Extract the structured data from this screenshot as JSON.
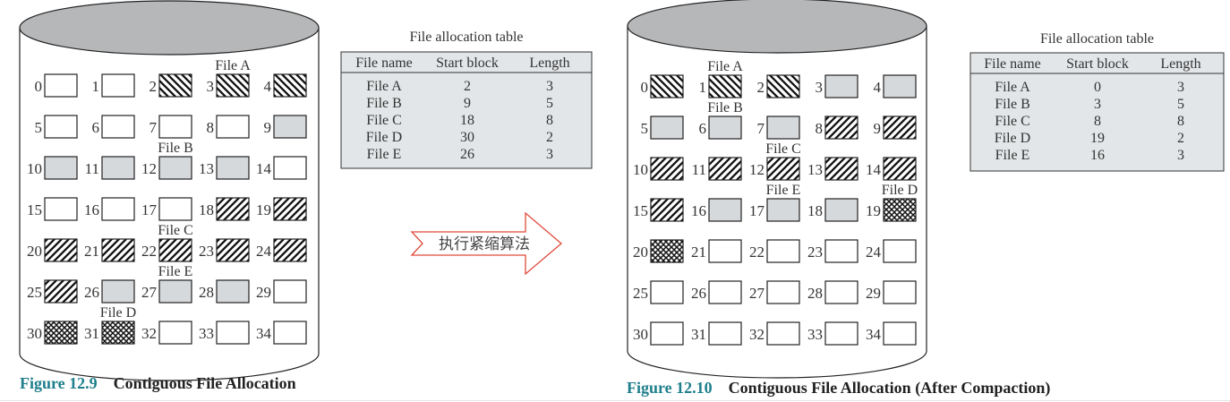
{
  "colors": {
    "used": "#d6d9db",
    "table_bg": "#e3e6e8",
    "cylinder_top": "#b5b7b9",
    "caption_accent": "#1f7f8c",
    "arrow": "#e04a3a"
  },
  "legend_patterns": {
    "A": "back-diagonal-hatch",
    "B": "grey-fill",
    "C": "forward-diagonal-hatch",
    "D": "cross-hatch",
    "E": "grey-fill"
  },
  "before": {
    "caption_num": "Figure 12.9",
    "caption_text": "Contiguous File Allocation",
    "blocks": [
      "empty",
      "empty",
      "A",
      "A",
      "A",
      "empty",
      "empty",
      "empty",
      "empty",
      "B",
      "B",
      "B",
      "B",
      "B",
      "empty",
      "empty",
      "empty",
      "empty",
      "C",
      "C",
      "C",
      "C",
      "C",
      "C",
      "C",
      "C",
      "E",
      "E",
      "E",
      "empty",
      "D",
      "D",
      "empty",
      "empty",
      "empty"
    ],
    "file_labels": [
      {
        "text": "File A",
        "row": 0,
        "col": 3
      },
      {
        "text": "File B",
        "row": 2,
        "col": 2
      },
      {
        "text": "File C",
        "row": 4,
        "col": 2
      },
      {
        "text": "File E",
        "row": 5,
        "col": 2
      },
      {
        "text": "File D",
        "row": 6,
        "col": 1
      }
    ],
    "table": {
      "title": "File allocation table",
      "headers": [
        "File name",
        "Start block",
        "Length"
      ],
      "rows": [
        [
          "File A",
          "2",
          "3"
        ],
        [
          "File B",
          "9",
          "5"
        ],
        [
          "File C",
          "18",
          "8"
        ],
        [
          "File D",
          "30",
          "2"
        ],
        [
          "File E",
          "26",
          "3"
        ]
      ]
    }
  },
  "arrow_label": "执行紧缩算法",
  "after": {
    "caption_num": "Figure 12.10",
    "caption_text": "Contiguous File Allocation (After Compaction)",
    "blocks": [
      "A",
      "A",
      "A",
      "B",
      "B",
      "B",
      "B",
      "B",
      "C",
      "C",
      "C",
      "C",
      "C",
      "C",
      "C",
      "C",
      "E",
      "E",
      "E",
      "D",
      "D",
      "empty",
      "empty",
      "empty",
      "empty",
      "empty",
      "empty",
      "empty",
      "empty",
      "empty",
      "empty",
      "empty",
      "empty",
      "empty",
      "empty"
    ],
    "file_labels": [
      {
        "text": "File A",
        "row": 0,
        "col": 1
      },
      {
        "text": "File B",
        "row": 1,
        "col": 1
      },
      {
        "text": "File C",
        "row": 2,
        "col": 2
      },
      {
        "text": "File E",
        "row": 3,
        "col": 2
      },
      {
        "text": "File D",
        "row": 3,
        "col": 4
      }
    ],
    "table": {
      "title": "File allocation table",
      "headers": [
        "File name",
        "Start block",
        "Length"
      ],
      "rows": [
        [
          "File A",
          "0",
          "3"
        ],
        [
          "File B",
          "3",
          "5"
        ],
        [
          "File C",
          "8",
          "8"
        ],
        [
          "File D",
          "19",
          "2"
        ],
        [
          "File E",
          "16",
          "3"
        ]
      ]
    }
  }
}
